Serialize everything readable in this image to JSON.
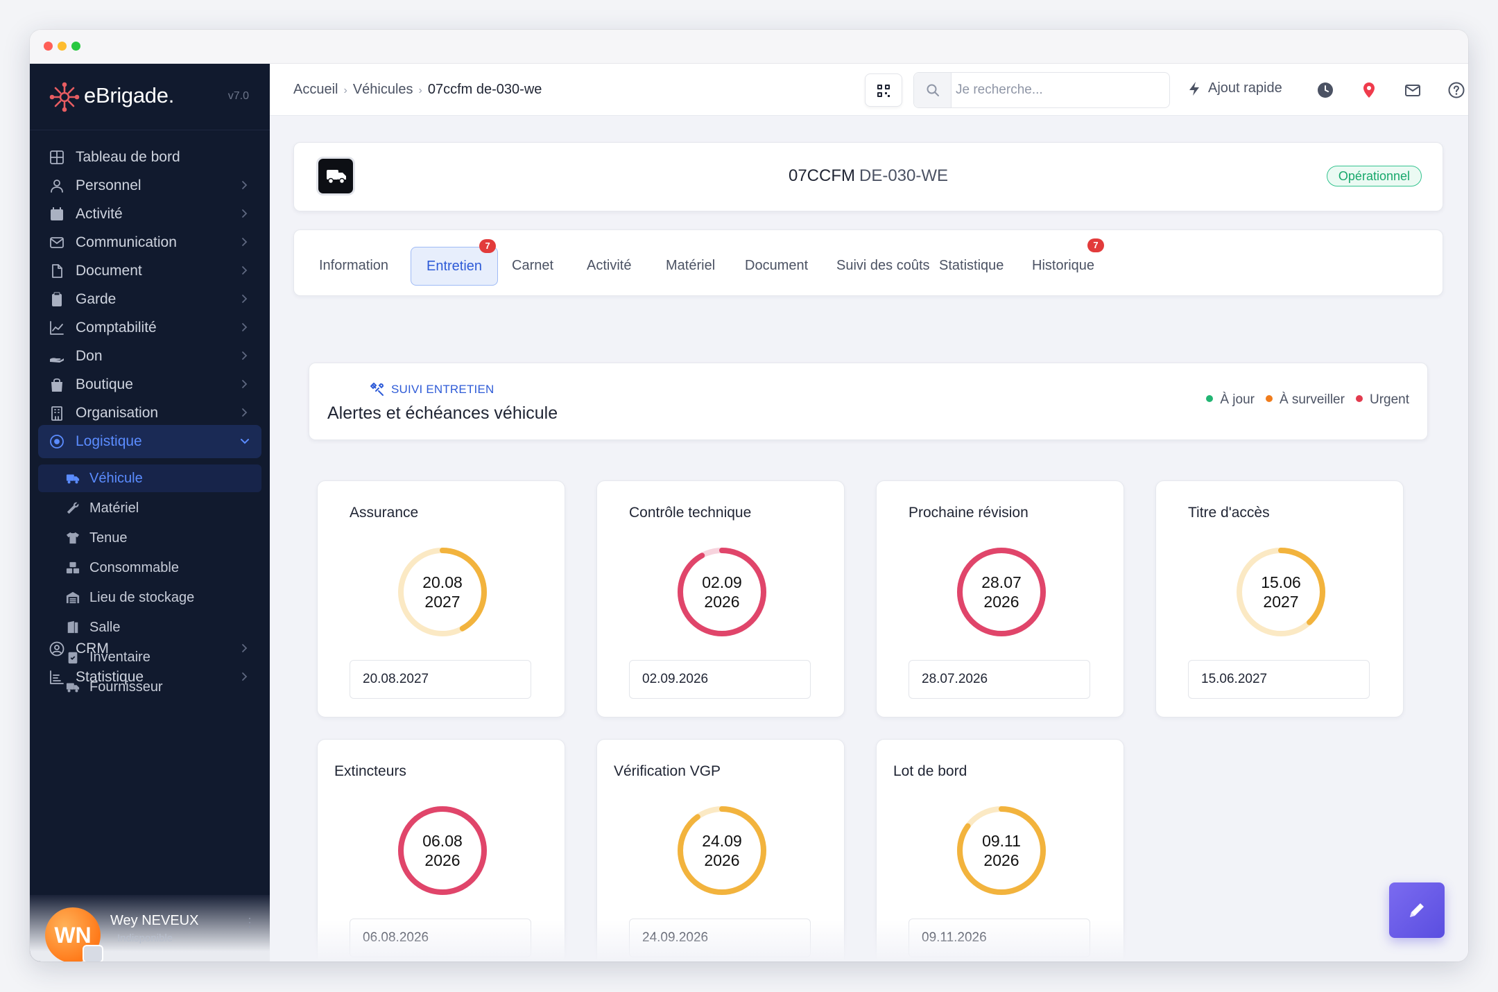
{
  "app": {
    "name": "eBrigade.",
    "version": "v7.0"
  },
  "sidebar": {
    "items": [
      {
        "label": "Tableau de bord",
        "icon": "dashboard-icon"
      },
      {
        "label": "Personnel",
        "icon": "user-icon"
      },
      {
        "label": "Activité",
        "icon": "calendar-icon"
      },
      {
        "label": "Communication",
        "icon": "mail-icon"
      },
      {
        "label": "Document",
        "icon": "file-icon"
      },
      {
        "label": "Garde",
        "icon": "clipboard-icon"
      },
      {
        "label": "Comptabilité",
        "icon": "chart-line-icon"
      },
      {
        "label": "Don",
        "icon": "hand-icon"
      },
      {
        "label": "Boutique",
        "icon": "bag-icon"
      },
      {
        "label": "Organisation",
        "icon": "building-icon"
      },
      {
        "label": "Logistique",
        "icon": "target-icon"
      },
      {
        "label": "CRM",
        "icon": "user-circle-icon"
      },
      {
        "label": "Statistique",
        "icon": "bar-chart-icon"
      }
    ],
    "logistique_sub": [
      {
        "label": "Véhicule",
        "icon": "truck-icon"
      },
      {
        "label": "Matériel",
        "icon": "wrench-icon"
      },
      {
        "label": "Tenue",
        "icon": "shirt-icon"
      },
      {
        "label": "Consommable",
        "icon": "boxes-icon"
      },
      {
        "label": "Lieu de stockage",
        "icon": "warehouse-icon"
      },
      {
        "label": "Salle",
        "icon": "door-icon"
      },
      {
        "label": "Inventaire",
        "icon": "clipboard-check-icon"
      },
      {
        "label": "Fournisseur",
        "icon": "truck-icon"
      }
    ],
    "user": {
      "initials": "WN",
      "name": "Wey NEVEUX",
      "status": "Indisponible"
    }
  },
  "topbar": {
    "breadcrumb": [
      "Accueil",
      "Véhicules",
      "07ccfm de-030-we"
    ],
    "search_placeholder": "Je recherche...",
    "quick_add": "Ajout rapide"
  },
  "vehicle": {
    "code": "07CCFM",
    "plate": "DE-030-WE",
    "status": "Opérationnel"
  },
  "tabs": [
    {
      "label": "Information"
    },
    {
      "label": "Entretien",
      "badge": "7",
      "active": true
    },
    {
      "label": "Carnet"
    },
    {
      "label": "Activité"
    },
    {
      "label": "Matériel"
    },
    {
      "label": "Document"
    },
    {
      "label": "Suivi des coûts"
    },
    {
      "label": "Statistique"
    },
    {
      "label": "Historique",
      "badge": "7"
    }
  ],
  "alerts": {
    "kicker": "SUIVI ENTRETIEN",
    "title": "Alertes et échéances véhicule",
    "legend": [
      {
        "label": "À jour",
        "color": "#22b573"
      },
      {
        "label": "À surveiller",
        "color": "#f07c1c"
      },
      {
        "label": "Urgent",
        "color": "#e23b4e"
      }
    ]
  },
  "due_items": [
    {
      "label": "Assurance",
      "ring_day": "20.08",
      "ring_year": "2027",
      "date": "20.08.2027",
      "level": 0.42,
      "color": "#f2b33d",
      "track": "#fbe9c4"
    },
    {
      "label": "Contrôle technique",
      "ring_day": "02.09",
      "ring_year": "2026",
      "date": "02.09.2026",
      "level": 0.92,
      "color": "#e0456a",
      "track": "#f7d3dd"
    },
    {
      "label": "Prochaine révision",
      "ring_day": "28.07",
      "ring_year": "2026",
      "date": "28.07.2026",
      "level": 1.0,
      "color": "#e0456a",
      "track": "#f7d3dd"
    },
    {
      "label": "Titre d'accès",
      "ring_day": "15.06",
      "ring_year": "2027",
      "date": "15.06.2027",
      "level": 0.38,
      "color": "#f2b33d",
      "track": "#fbe9c4"
    },
    {
      "label": "Extincteurs",
      "ring_day": "06.08",
      "ring_year": "2026",
      "date": "06.08.2026",
      "level": 1.0,
      "color": "#e0456a",
      "track": "#f7d3dd"
    },
    {
      "label": "Vérification VGP",
      "ring_day": "24.09",
      "ring_year": "2026",
      "date": "24.09.2026",
      "level": 0.9,
      "color": "#f2b33d",
      "track": "#fbe9c4"
    },
    {
      "label": "Lot de bord",
      "ring_day": "09.11",
      "ring_year": "2026",
      "date": "09.11.2026",
      "level": 0.85,
      "color": "#f2b33d",
      "track": "#fbe9c4"
    }
  ]
}
